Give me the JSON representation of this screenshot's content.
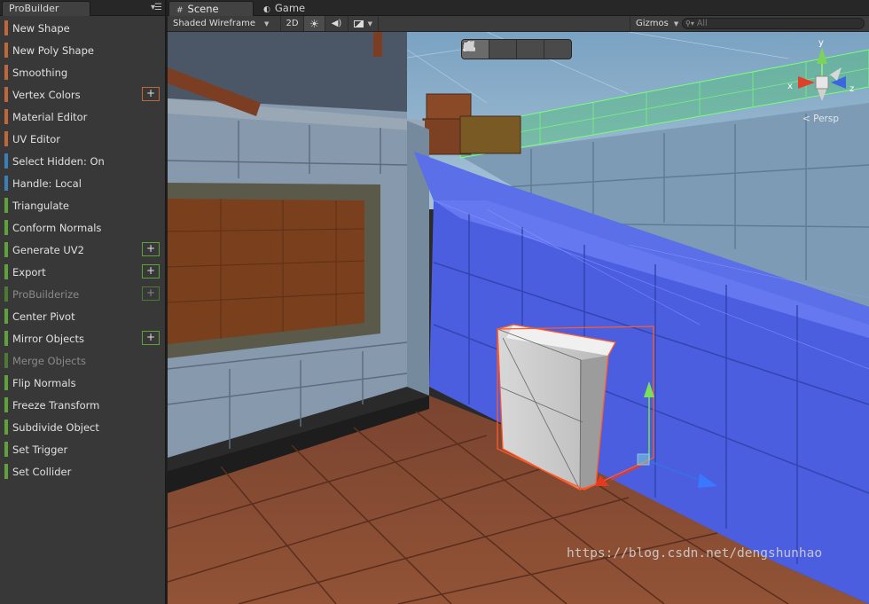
{
  "probuilder": {
    "tab_title": "ProBuilder",
    "menu_icon": "list-menu-icon",
    "items": [
      {
        "label": "New Shape",
        "color": "#c0673a",
        "plus": false,
        "disabled": false
      },
      {
        "label": "New Poly Shape",
        "color": "#c0673a",
        "plus": false,
        "disabled": false
      },
      {
        "label": "Smoothing",
        "color": "#c0673a",
        "plus": false,
        "disabled": false
      },
      {
        "label": "Vertex Colors",
        "color": "#c0673a",
        "plus": true,
        "plus_color": "#c0673a",
        "disabled": false
      },
      {
        "label": "Material Editor",
        "color": "#c0673a",
        "plus": false,
        "disabled": false
      },
      {
        "label": "UV Editor",
        "color": "#c0673a",
        "plus": false,
        "disabled": false
      },
      {
        "label": "Select Hidden: On",
        "color": "#3a7fb8",
        "plus": false,
        "disabled": false
      },
      {
        "label": "Handle: Local",
        "color": "#3a7fb8",
        "plus": false,
        "disabled": false
      },
      {
        "label": "Triangulate",
        "color": "#5fa23a",
        "plus": false,
        "disabled": false
      },
      {
        "label": "Conform Normals",
        "color": "#5fa23a",
        "plus": false,
        "disabled": false
      },
      {
        "label": "Generate UV2",
        "color": "#5fa23a",
        "plus": true,
        "plus_color": "#5fa23a",
        "disabled": false
      },
      {
        "label": "Export",
        "color": "#5fa23a",
        "plus": true,
        "plus_color": "#5fa23a",
        "disabled": false
      },
      {
        "label": "ProBuilderize",
        "color": "#4c7a32",
        "plus": true,
        "plus_color": "#4c7a32",
        "disabled": true
      },
      {
        "label": "Center Pivot",
        "color": "#5fa23a",
        "plus": false,
        "disabled": false
      },
      {
        "label": "Mirror Objects",
        "color": "#5fa23a",
        "plus": true,
        "plus_color": "#5fa23a",
        "disabled": false
      },
      {
        "label": "Merge Objects",
        "color": "#4c7a32",
        "plus": false,
        "disabled": true
      },
      {
        "label": "Flip Normals",
        "color": "#5fa23a",
        "plus": false,
        "disabled": false
      },
      {
        "label": "Freeze Transform",
        "color": "#5fa23a",
        "plus": false,
        "disabled": false
      },
      {
        "label": "Subdivide Object",
        "color": "#5fa23a",
        "plus": false,
        "disabled": false
      },
      {
        "label": "Set Trigger",
        "color": "#5fa23a",
        "plus": false,
        "disabled": false
      },
      {
        "label": "Set Collider",
        "color": "#5fa23a",
        "plus": false,
        "disabled": false
      }
    ]
  },
  "scene": {
    "tabs": [
      {
        "label": "Scene",
        "icon": "scene-grid-icon",
        "active": true
      },
      {
        "label": "Game",
        "icon": "game-pacman-icon",
        "active": false
      }
    ],
    "toolbar": {
      "shading_mode": "Shaded Wireframe",
      "mode_2d": "2D",
      "lighting_icon": "sun-icon",
      "audio_icon": "speaker-icon",
      "effects_icon": "image-effects-icon",
      "gizmos": "Gizmos",
      "search_placeholder": "All",
      "search_icon": "search-icon"
    },
    "mode_toolbar": {
      "modes": [
        "object-mode-icon",
        "vertex-mode-icon",
        "edge-mode-icon",
        "face-mode-icon"
      ],
      "active": "object-mode-icon"
    },
    "axis_gizmo": {
      "x": "x",
      "y": "y",
      "z": "z",
      "projection": "< Persp"
    },
    "colors": {
      "selection_outline": "#ff5a2a",
      "wireframe_green": "#7aff7a",
      "wall_blue": "#4a5de0",
      "floor_brown": "#8a4e32"
    }
  },
  "watermark": "https://blog.csdn.net/dengshunhao"
}
